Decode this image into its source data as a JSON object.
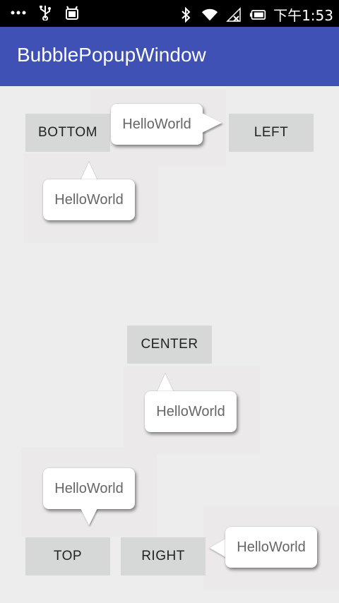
{
  "status_bar": {
    "time": "下午1:53",
    "left_icons": [
      "more-dots-icon",
      "usb-icon",
      "android-debug-icon"
    ],
    "right_icons": [
      "bluetooth-icon",
      "wifi-icon",
      "no-signal-icon",
      "battery-icon"
    ]
  },
  "app_bar": {
    "title": "BubblePopupWindow"
  },
  "buttons": {
    "bottom": "BOTTOM",
    "left": "LEFT",
    "center": "CENTER",
    "top": "TOP",
    "right": "RIGHT"
  },
  "bubbles": {
    "bottom_popup": "HelloWorld",
    "left_popup": "HelloWorld",
    "center_popup": "HelloWorld",
    "top_popup": "HelloWorld",
    "right_popup": "HelloWorld"
  },
  "colors": {
    "app_bar": "#3f51b5",
    "background": "#eeeded",
    "button": "#d6d7d7",
    "status_bar": "#000000"
  }
}
